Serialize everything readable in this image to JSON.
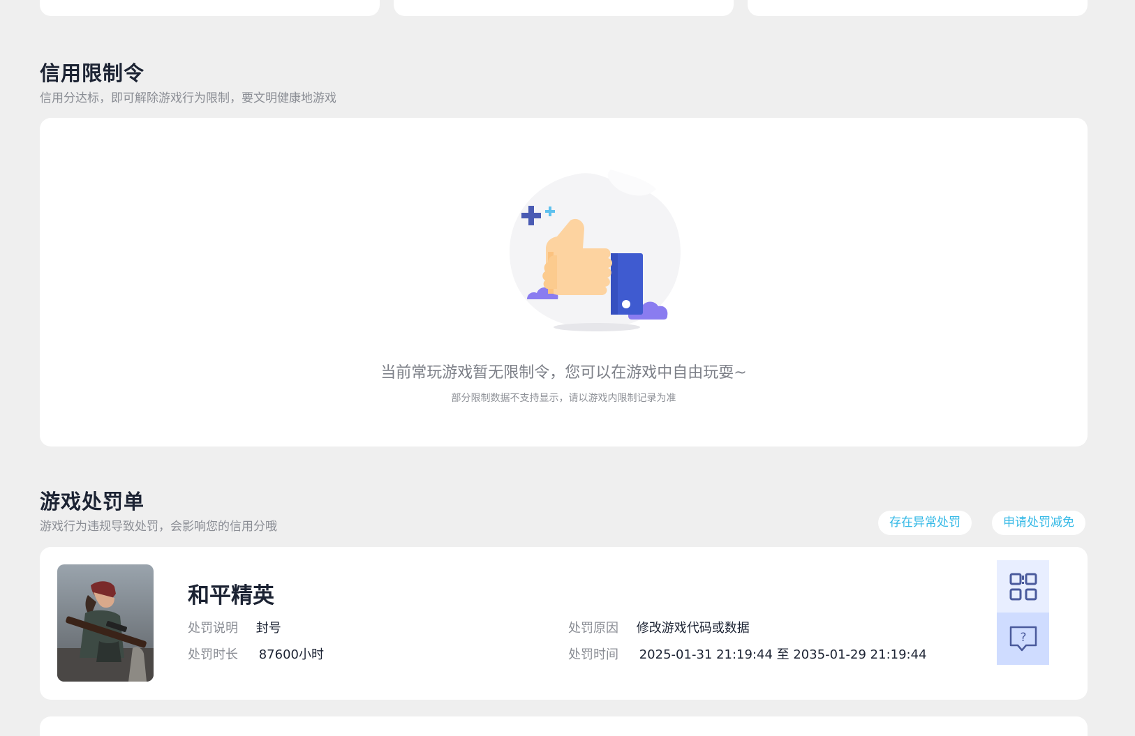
{
  "credit_section": {
    "title": "信用限制令",
    "subtitle": "信用分达标，即可解除游戏行为限制，要文明健康地游戏",
    "empty_main": "当前常玩游戏暂无限制令，您可以在游戏中自由玩耍~",
    "empty_sub": "部分限制数据不支持显示，请以游戏内限制记录为准"
  },
  "punish_section": {
    "title": "游戏处罚单",
    "subtitle": "游戏行为违规导致处罚，会影响您的信用分哦",
    "btn_abnormal": "存在异常处罚",
    "btn_reduce": "申请处罚减免"
  },
  "punishment": {
    "game_name": "和平精英",
    "desc_label": "处罚说明",
    "desc_value": "封号",
    "duration_label": "处罚时长",
    "duration_value": "87600小时",
    "reason_label": "处罚原因",
    "reason_value": "修改游戏代码或数据",
    "time_label": "处罚时间",
    "time_value": "2025-01-31 21:19:44 至 2035-01-29 21:19:44"
  },
  "icons": {
    "qr": "qr-code-icon",
    "help": "help-chat-icon"
  },
  "colors": {
    "accent": "#33b8e6",
    "icon": "#4a5a9c",
    "background": "#efefef"
  }
}
